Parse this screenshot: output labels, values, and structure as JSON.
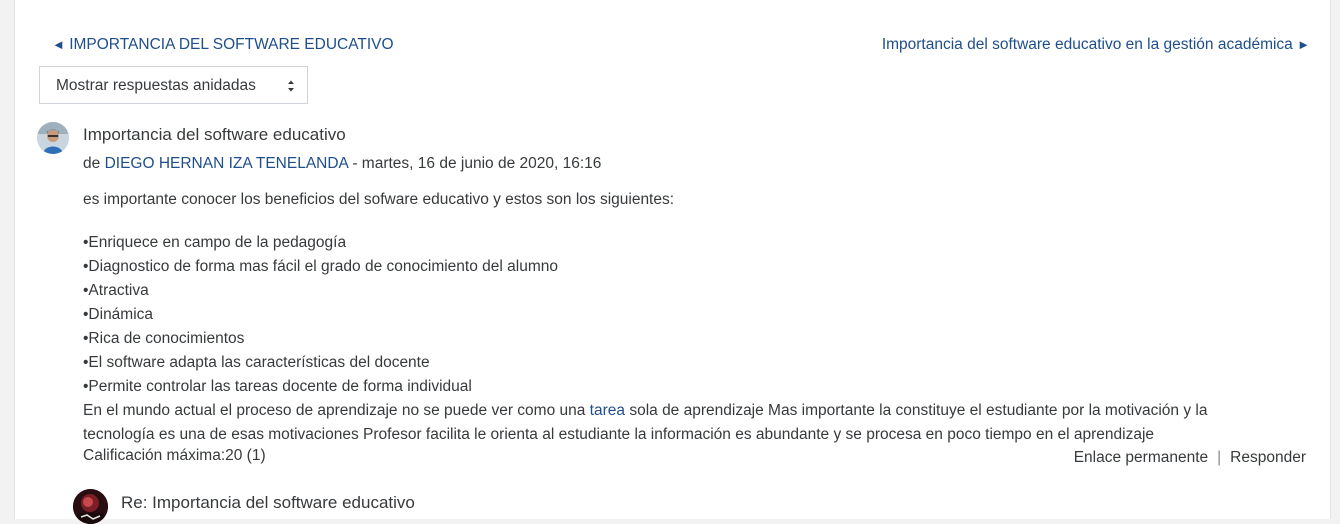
{
  "nav": {
    "prev_label": "IMPORTANCIA DEL SOFTWARE EDUCATIVO",
    "prev_arrow": "◄",
    "next_label": "Importancia del software educativo en la gestión académica",
    "next_arrow": "►"
  },
  "display_mode": {
    "selected": "Mostrar respuestas anidadas"
  },
  "post": {
    "title": "Importancia del software educativo",
    "by_prefix": "de",
    "author": "DIEGO HERNAN IZA TENELANDA",
    "date": "- martes, 16 de junio de 2020, 16:16",
    "intro": "es importante conocer los beneficios del sofware educativo y estos son los siguientes:",
    "bullets": [
      "•Enriquece en campo de la pedagogía",
      "•Diagnostico de forma mas fácil el grado de conocimiento del alumno",
      "•Atractiva",
      "•Dinámica",
      "•Rica de conocimientos",
      "•El software adapta las características del docente",
      "•Permite controlar las tareas docente de forma individual"
    ],
    "paragraph_before": "En el mundo actual el proceso de aprendizaje no se puede ver como una ",
    "paragraph_link": "tarea",
    "paragraph_after": " sola de aprendizaje Mas importante la constituye el estudiante por la motivación y la tecnología es una de esas motivaciones Profesor facilita le orienta al estudiante la información es abundante y se procesa en poco tiempo en el aprendizaje",
    "grade": "Calificación máxima:20 (1)",
    "permalink_label": "Enlace permanente",
    "separator": "|",
    "reply_label": "Responder"
  },
  "reply": {
    "title": "Re: Importancia del software educativo"
  }
}
